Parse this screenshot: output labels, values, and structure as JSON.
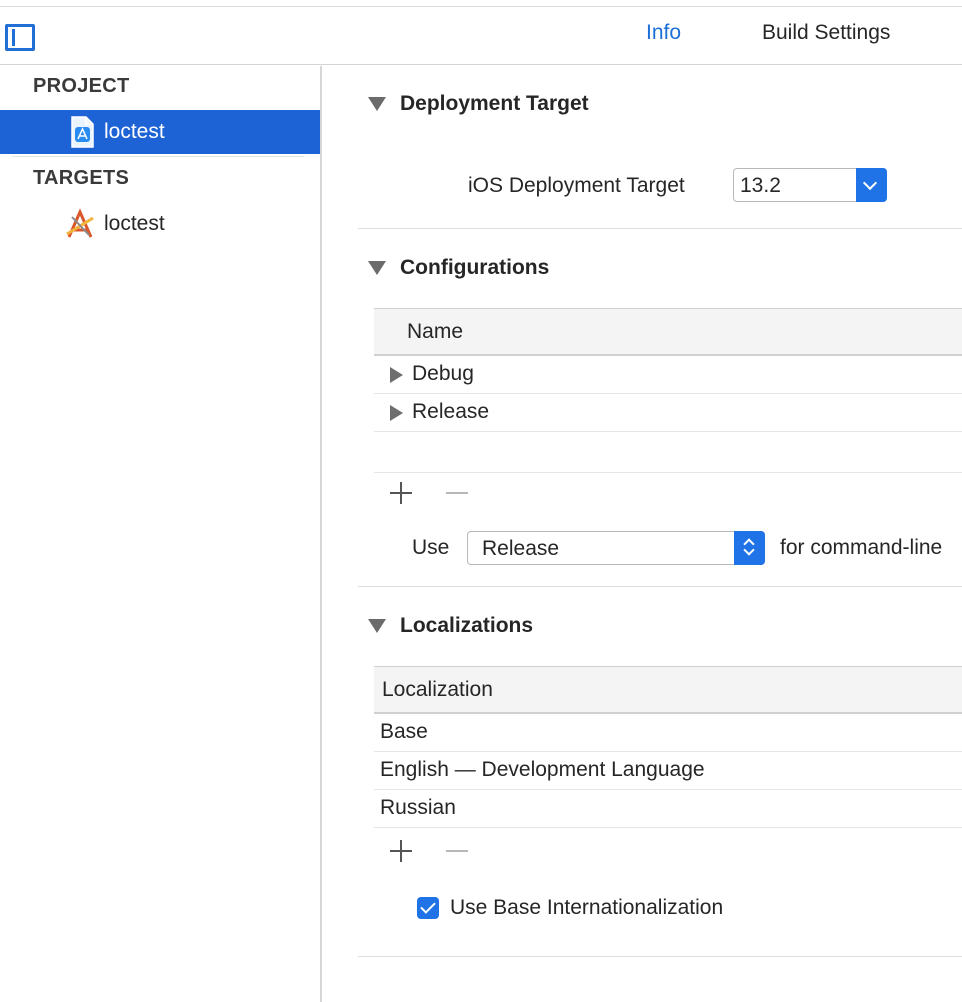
{
  "toolbar": {
    "tabs": [
      {
        "label": "Info",
        "selected": true
      },
      {
        "label": "Build Settings",
        "selected": false
      }
    ]
  },
  "sidebar": {
    "project_header": "PROJECT",
    "project_item": "loctest",
    "targets_header": "TARGETS",
    "target_item": "loctest"
  },
  "deployment": {
    "title": "Deployment Target",
    "label": "iOS Deployment Target",
    "value": "13.2"
  },
  "configurations": {
    "title": "Configurations",
    "column_name": "Name",
    "rows": [
      "Debug",
      "Release"
    ],
    "use_label": "Use",
    "use_value": "Release",
    "use_suffix": "for command-line"
  },
  "localizations": {
    "title": "Localizations",
    "column_name": "Localization",
    "rows": [
      "Base",
      "English — Development Language",
      "Russian"
    ],
    "use_base_label": "Use Base Internationalization",
    "use_base_checked": true
  },
  "colors": {
    "accent": "#1d63d6",
    "tab_selected": "#1d6fd6"
  }
}
